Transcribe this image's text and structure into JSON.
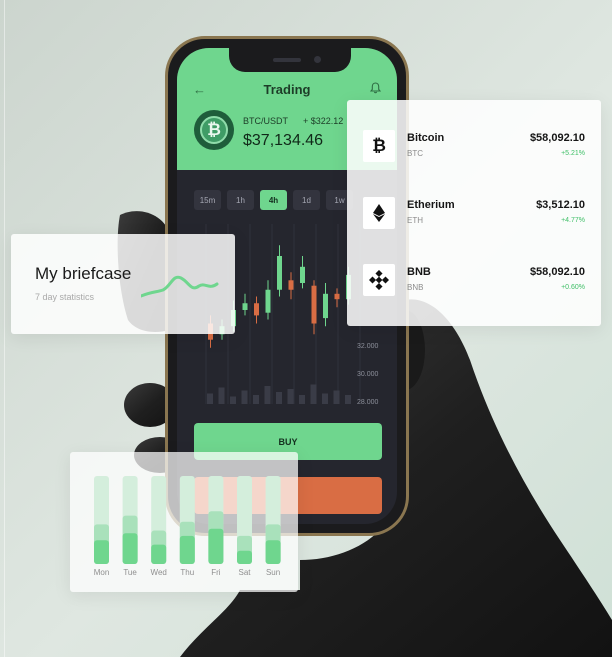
{
  "colors": {
    "accent_green": "#6fd68e",
    "sell_orange": "#d96d44",
    "positive": "#3fbf67",
    "screen_dark": "#25262e"
  },
  "app": {
    "title": "Trading",
    "back_icon": "arrow-left-icon",
    "bell_icon": "bell-icon",
    "coin_icon": "bitcoin-icon",
    "pair": "BTC/USDT",
    "change": "+ $322.12",
    "price": "$37,134.46",
    "timeframes": [
      "15m",
      "1h",
      "4h",
      "1d",
      "1w"
    ],
    "active_timeframe": "4h",
    "price_axis": [
      "32.000",
      "30.000",
      "28.000"
    ],
    "buy_label": "BUY"
  },
  "coins": [
    {
      "name": "Bitcoin",
      "symbol": "BTC",
      "price": "$58,092.10",
      "change": "+5.21%",
      "icon": "bitcoin-icon"
    },
    {
      "name": "Etherium",
      "symbol": "ETH",
      "price": "$3,512.10",
      "change": "+4.77%",
      "icon": "ethereum-icon"
    },
    {
      "name": "BNB",
      "symbol": "BNB",
      "price": "$58,092.10",
      "change": "+0.60%",
      "icon": "bnb-icon"
    }
  ],
  "briefcase": {
    "title": "My briefcase",
    "subtitle": "7 day statistics"
  },
  "week": {
    "days": [
      "Mon",
      "Tue",
      "Wed",
      "Thu",
      "Fri",
      "Sat",
      "Sun"
    ],
    "levels": [
      {
        "low": 0.27,
        "mid": 0.45
      },
      {
        "low": 0.35,
        "mid": 0.55
      },
      {
        "low": 0.22,
        "mid": 0.38
      },
      {
        "low": 0.32,
        "mid": 0.48
      },
      {
        "low": 0.4,
        "mid": 0.6
      },
      {
        "low": 0.15,
        "mid": 0.32
      },
      {
        "low": 0.27,
        "mid": 0.45
      }
    ]
  },
  "candles": [
    {
      "o": 0.3,
      "c": 0.18,
      "h": 0.36,
      "l": 0.12
    },
    {
      "o": 0.22,
      "c": 0.28,
      "h": 0.33,
      "l": 0.18
    },
    {
      "o": 0.28,
      "c": 0.4,
      "h": 0.47,
      "l": 0.24
    },
    {
      "o": 0.4,
      "c": 0.45,
      "h": 0.52,
      "l": 0.36
    },
    {
      "o": 0.45,
      "c": 0.36,
      "h": 0.5,
      "l": 0.3
    },
    {
      "o": 0.38,
      "c": 0.55,
      "h": 0.62,
      "l": 0.33
    },
    {
      "o": 0.55,
      "c": 0.8,
      "h": 0.88,
      "l": 0.5
    },
    {
      "o": 0.62,
      "c": 0.55,
      "h": 0.68,
      "l": 0.48
    },
    {
      "o": 0.6,
      "c": 0.72,
      "h": 0.8,
      "l": 0.56
    },
    {
      "o": 0.58,
      "c": 0.3,
      "h": 0.62,
      "l": 0.22
    },
    {
      "o": 0.34,
      "c": 0.52,
      "h": 0.6,
      "l": 0.28
    },
    {
      "o": 0.52,
      "c": 0.48,
      "h": 0.56,
      "l": 0.42
    },
    {
      "o": 0.48,
      "c": 0.66,
      "h": 0.72,
      "l": 0.44
    }
  ],
  "volumes": [
    0.35,
    0.55,
    0.25,
    0.45,
    0.3,
    0.6,
    0.4,
    0.5,
    0.3,
    0.65,
    0.35,
    0.45,
    0.3
  ]
}
